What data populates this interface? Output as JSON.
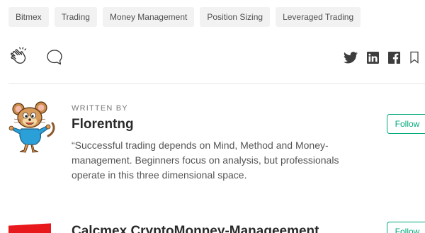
{
  "tags": [
    "Bitmex",
    "Trading",
    "Money Management",
    "Position Sizing",
    "Leveraged Trading"
  ],
  "author": {
    "written_by": "WRITTEN BY",
    "name": "Florentng",
    "bio": "“Successful trading depends on Mind, Method and Money-management. Beginners focus on analysis, but professionals operate in this three dimensional space.",
    "follow_label": "Follow"
  },
  "publication": {
    "name": "Calcmex CryptoMonney-Manageement",
    "follow_label": "Follow"
  },
  "colors": {
    "accent": "#03a87c",
    "tag_bg": "#f2f2f2",
    "publication_logo": "#e8191c"
  },
  "icons": [
    "clap-icon",
    "comment-icon",
    "twitter-icon",
    "linkedin-icon",
    "facebook-icon",
    "bookmark-icon"
  ]
}
